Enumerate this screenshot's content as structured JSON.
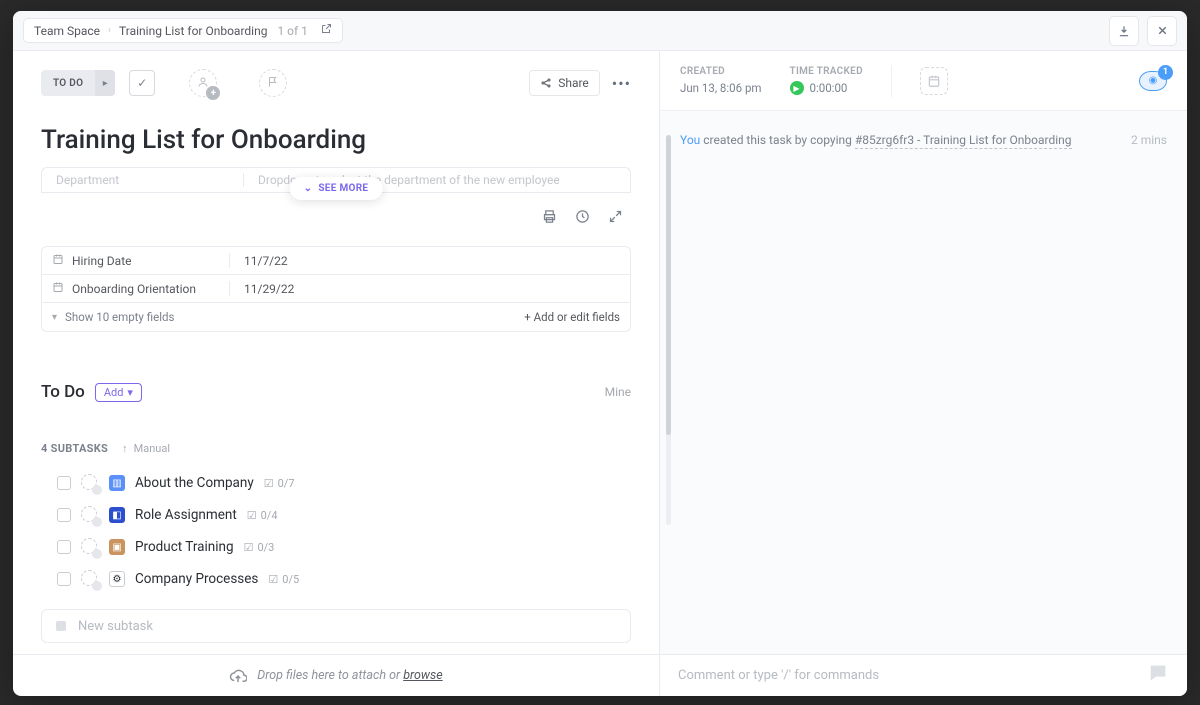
{
  "breadcrumb": {
    "space": "Team Space",
    "item": "Training List for Onboarding",
    "count": "1 of 1"
  },
  "toolbar": {
    "status": "TO DO",
    "share": "Share"
  },
  "title": "Training List for Onboarding",
  "description_peek": {
    "col1": "Department",
    "col2": "Dropdown to select the department of the new employee",
    "see_more": "SEE MORE"
  },
  "custom_fields": {
    "rows": [
      {
        "name": "Hiring Date",
        "value": "11/7/22"
      },
      {
        "name": "Onboarding Orientation",
        "value": "11/29/22"
      }
    ],
    "show_empty": "Show 10 empty fields",
    "add_edit": "+ Add or edit fields"
  },
  "section": {
    "name": "To Do",
    "add": "Add",
    "mine": "Mine"
  },
  "subtasks_meta": {
    "count_label": "4 SUBTASKS",
    "sort": "Manual"
  },
  "subtasks": [
    {
      "title": "About the Company",
      "progress": "0/7",
      "icon": "blue"
    },
    {
      "title": "Role Assignment",
      "progress": "0/4",
      "icon": "darkblue"
    },
    {
      "title": "Product Training",
      "progress": "0/3",
      "icon": "box"
    },
    {
      "title": "Company Processes",
      "progress": "0/5",
      "icon": "gear"
    }
  ],
  "new_subtask_placeholder": "New subtask",
  "attach_prompt": {
    "prefix": "Drop files here to attach or ",
    "link": "browse"
  },
  "comment_placeholder": "Comment or type '/' for commands",
  "stats": {
    "created_label": "CREATED",
    "created_value": "Jun 13, 8:06 pm",
    "time_label": "TIME TRACKED",
    "time_value": "0:00:00",
    "watchers": "1"
  },
  "activity": {
    "actor": "You",
    "text": " created this task by copying ",
    "link": "#85zrg6fr3 - Training List for Onboarding",
    "time": "2 mins"
  }
}
